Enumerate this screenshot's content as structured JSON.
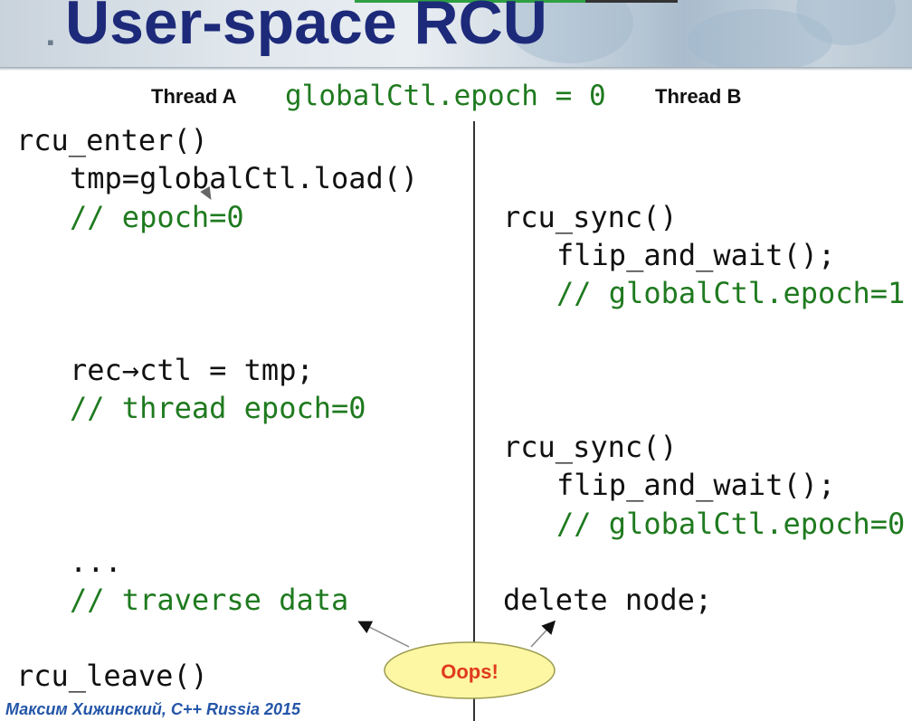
{
  "slide": {
    "title": "User-space RCU",
    "footer": "Максим Хижинский, C++ Russia 2015"
  },
  "header_row": {
    "thread_a": "Thread A",
    "thread_b": "Thread B",
    "epoch": "globalCtl.epoch = 0"
  },
  "thread_a": {
    "line1": "rcu_enter()",
    "line2": "tmp=globalCtl.load()",
    "line3": "// epoch=0",
    "line4": "rec→ctl = tmp;",
    "line5": "// thread epoch=0",
    "line6": "...",
    "line7": "// traverse data",
    "line8": "rcu_leave()"
  },
  "thread_b": {
    "sync1": "rcu_sync()",
    "flip1": "flip_and_wait();",
    "comment1": "// globalCtl.epoch=1",
    "sync2": "rcu_sync()",
    "flip2": "flip_and_wait();",
    "comment2": "// globalCtl.epoch=0",
    "delete": "delete node;"
  },
  "callout": {
    "text": "Oops!"
  },
  "colors": {
    "title": "#1d2a7a",
    "comment": "#1f7a1f",
    "callout_fill": "#fdf6a3",
    "callout_text": "#e03a1e",
    "footer": "#2456a8"
  }
}
